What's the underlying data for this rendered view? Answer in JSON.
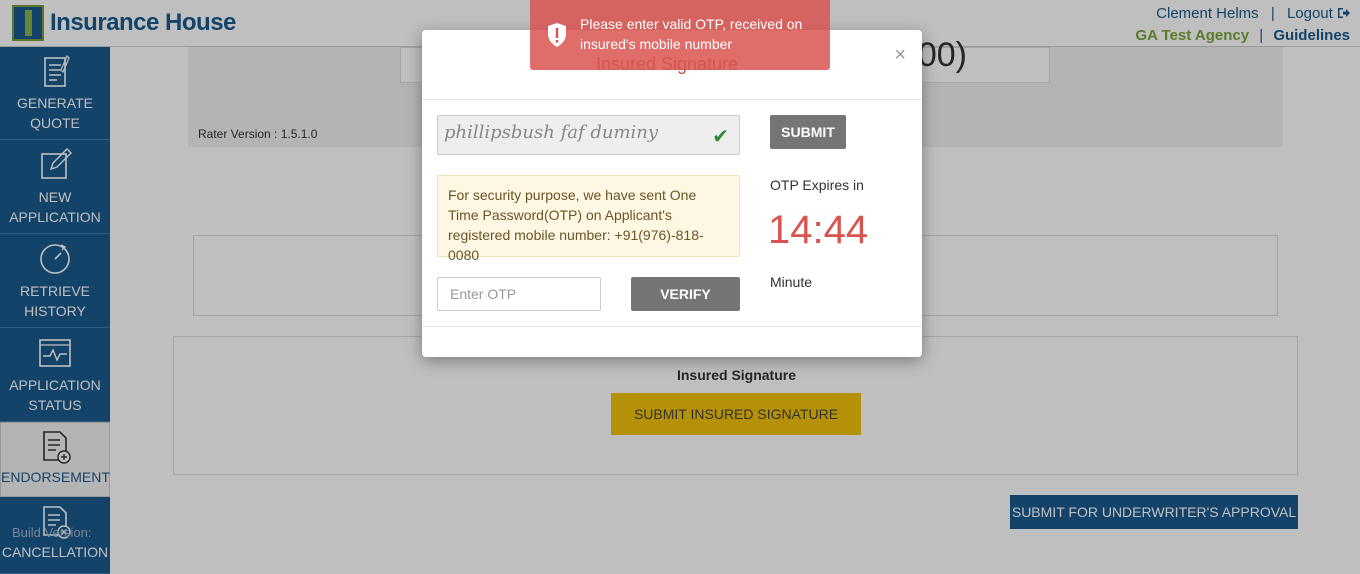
{
  "header": {
    "brand": "Insurance House",
    "user_name": "Clement Helms",
    "separator": "|",
    "logout": "Logout",
    "agency": "GA Test Agency",
    "guidelines": "Guidelines"
  },
  "sidebar": {
    "items": [
      {
        "label1": "GENERATE",
        "label2": "QUOTE"
      },
      {
        "label1": "NEW",
        "label2": "APPLICATION"
      },
      {
        "label1": "RETRIEVE",
        "label2": "HISTORY"
      },
      {
        "label1": "APPLICATION",
        "label2": "STATUS"
      },
      {
        "label1": "ENDORSEMENT",
        "label2": ""
      },
      {
        "label1": "CANCELLATION",
        "label2": ""
      }
    ],
    "build_version": "Build Version:"
  },
  "main": {
    "top_text": "00)",
    "rater_version": "Rater Version : 1.5.1.0",
    "insured_signature_label": "Insured Signature",
    "submit_signature_button": "SUBMIT INSURED SIGNATURE",
    "submit_underwriter_button": "SUBMIT FOR UNDERWRITER'S APPROVAL"
  },
  "modal": {
    "title": "Insured Signature",
    "close": "×",
    "signature_value": "phillipsbush faf duminy",
    "submit": "SUBMIT",
    "info_text": "For security purpose, we have sent One Time Password(OTP) on Applicant's registered mobile number: +91(976)-818-0080",
    "otp_placeholder": "Enter OTP",
    "verify": "VERIFY",
    "expires_label": "OTP Expires in",
    "timer": "14:44",
    "minute_label": "Minute"
  },
  "toast": {
    "message": "Please enter valid OTP, received on insured's mobile number"
  },
  "colors": {
    "brand_blue": "#1b5a8e",
    "agency_green": "#7aa63a",
    "timer_red": "#d9534f",
    "signature_yellow": "#f0c20a"
  }
}
